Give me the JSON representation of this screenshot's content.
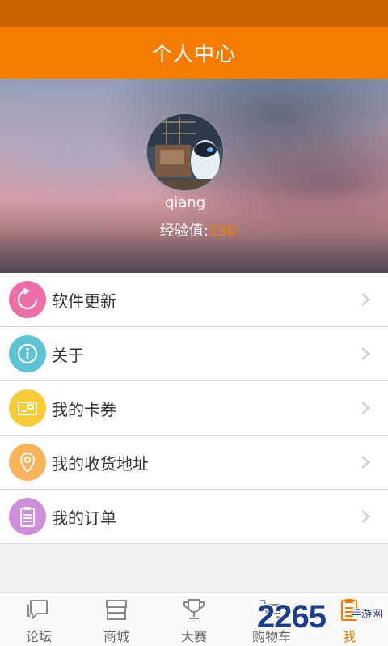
{
  "header": {
    "title": "个人中心"
  },
  "profile": {
    "username": "qiang",
    "exp_label": "经验值:",
    "exp_value": "130"
  },
  "menu": {
    "items": [
      {
        "label": "软件更新",
        "icon": "refresh-icon",
        "color": "#ec6fa8"
      },
      {
        "label": "关于",
        "icon": "info-icon",
        "color": "#5fc3d6"
      },
      {
        "label": "我的卡券",
        "icon": "card-icon",
        "color": "#f7cb3a"
      },
      {
        "label": "我的收货地址",
        "icon": "location-pin-icon",
        "color": "#f9b35a"
      },
      {
        "label": "我的订单",
        "icon": "clipboard-icon",
        "color": "#cf8ed9"
      }
    ]
  },
  "tabbar": {
    "tabs": [
      {
        "label": "论坛",
        "icon": "chat-bubble-icon"
      },
      {
        "label": "商城",
        "icon": "store-icon"
      },
      {
        "label": "大赛",
        "icon": "trophy-icon"
      },
      {
        "label": "购物车",
        "icon": "cart-icon"
      },
      {
        "label": "我",
        "icon": "clipboard-icon",
        "active": true
      }
    ]
  },
  "watermark": {
    "number": "2265",
    "text": "手游网"
  },
  "colors": {
    "accent": "#f57c00",
    "status_bar": "#cc6100"
  }
}
